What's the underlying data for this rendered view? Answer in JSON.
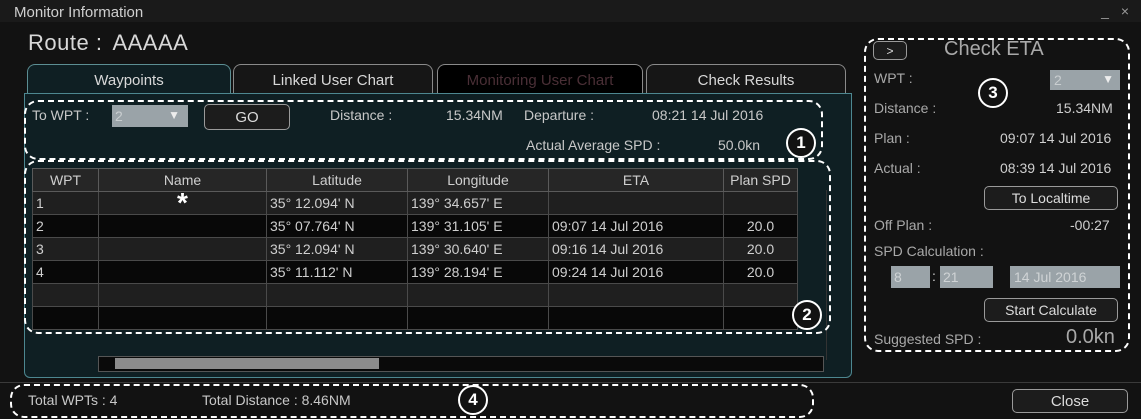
{
  "window": {
    "title": "Monitor Information",
    "controls": "_ ×"
  },
  "route": {
    "label": "Route :",
    "name": "AAAAA"
  },
  "tabs": [
    {
      "label": "Waypoints",
      "state": "active"
    },
    {
      "label": "Linked User Chart",
      "state": "normal"
    },
    {
      "label": "Monitoring User Chart",
      "state": "disabled"
    },
    {
      "label": "Check Results",
      "state": "normal"
    }
  ],
  "summary": {
    "to_wpt_label": "To WPT :",
    "to_wpt_value": "2",
    "go_label": "GO",
    "distance_label": "Distance :",
    "distance_value": "15.34NM",
    "departure_label": "Departure :",
    "departure_value": "08:21 14 Jul 2016",
    "avg_spd_label": "Actual Average SPD :",
    "avg_spd_value": "50.0kn"
  },
  "table": {
    "headers": [
      "WPT",
      "Name",
      "Latitude",
      "Longitude",
      "ETA",
      "Plan SPD"
    ],
    "rows": [
      {
        "wpt": "1",
        "name": "*",
        "lat": "35° 12.094' N",
        "lon": "139° 34.657' E",
        "eta": "",
        "spd": ""
      },
      {
        "wpt": "2",
        "name": "",
        "lat": "35° 07.764' N",
        "lon": "139° 31.105' E",
        "eta": "09:07 14 Jul 2016",
        "spd": "20.0"
      },
      {
        "wpt": "3",
        "name": "",
        "lat": "35° 12.094' N",
        "lon": "139° 30.640' E",
        "eta": "09:16 14 Jul 2016",
        "spd": "20.0"
      },
      {
        "wpt": "4",
        "name": "",
        "lat": "35° 11.112' N",
        "lon": "139° 28.194' E",
        "eta": "09:24 14 Jul 2016",
        "spd": "20.0"
      },
      {
        "wpt": "",
        "name": "",
        "lat": "",
        "lon": "",
        "eta": "",
        "spd": ""
      },
      {
        "wpt": "",
        "name": "",
        "lat": "",
        "lon": "",
        "eta": "",
        "spd": ""
      }
    ]
  },
  "check_eta": {
    "expand_label": ">",
    "title": "Check ETA",
    "wpt_label": "WPT :",
    "wpt_value": "2",
    "distance_label": "Distance :",
    "distance_value": "15.34NM",
    "plan_label": "Plan :",
    "plan_value": "09:07 14 Jul 2016",
    "actual_label": "Actual :",
    "actual_value": "08:39 14 Jul 2016",
    "localtime_label": "To Localtime",
    "offplan_label": "Off Plan :",
    "offplan_value": "-00:27",
    "spd_calc_label": "SPD Calculation :",
    "hour": "8",
    "colon": ":",
    "minute": "21",
    "date": "14 Jul 2016",
    "start_label": "Start Calculate",
    "suggested_label": "Suggested SPD :",
    "suggested_value": "0.0kn"
  },
  "footer": {
    "total_wpts": "Total WPTs : 4",
    "total_distance": "Total Distance : 8.46NM",
    "close_label": "Close"
  },
  "callouts": [
    "1",
    "2",
    "3",
    "4"
  ],
  "colors": {
    "panel_border": "#4d8790",
    "background": "#121212",
    "callout": "#ffffff"
  }
}
